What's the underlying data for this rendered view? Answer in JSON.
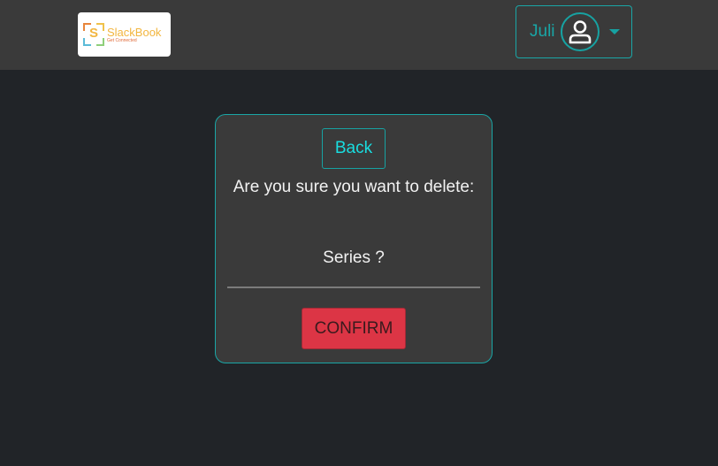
{
  "navbar": {
    "logo": {
      "letter": "S",
      "name": "SlackBook",
      "tagline": "Get Connected"
    },
    "user_menu": {
      "username": "Juli",
      "avatar_icon": "user-icon",
      "caret_icon": "caret-down-icon"
    }
  },
  "dialog": {
    "back_label": "Back",
    "prompt": "Are you sure you want to delete:",
    "item_label": "Series ?",
    "confirm_label": "CONFIRM"
  },
  "colors": {
    "background": "#212428",
    "navbar": "#3a3a3a",
    "card": "#3a3a3a",
    "accent": "#17a2a2",
    "danger": "#dc3545"
  }
}
